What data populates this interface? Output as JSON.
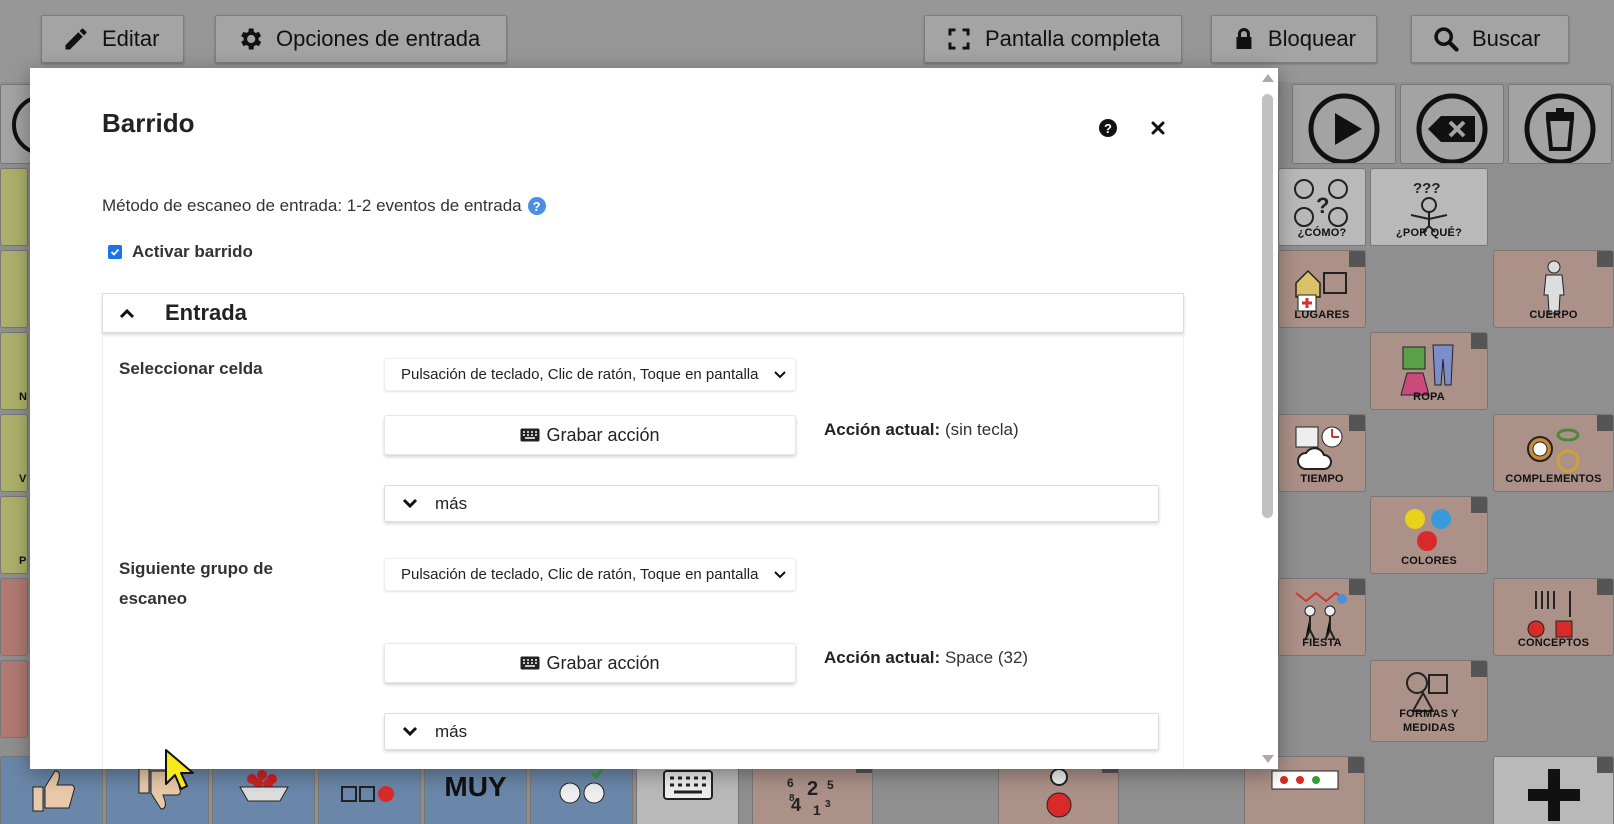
{
  "toolbar": {
    "edit_label": "Editar",
    "input_options_label": "Opciones de entrada",
    "fullscreen_label": "Pantalla completa",
    "lock_label": "Bloquear",
    "search_label": "Buscar"
  },
  "grid_cells": {
    "como": "¿CÓMO?",
    "porque": "¿POR QUÉ?",
    "lugares": "LUGARES",
    "cuerpo": "CUERPO",
    "ropa": "ROPA",
    "tiempo": "TIEMPO",
    "complementos": "COMPLEMENTOS",
    "colores": "COLORES",
    "fiesta": "FIESTA",
    "conceptos": "CONCEPTOS",
    "formas": "FORMAS Y\nMEDIDAS",
    "muy": "MUY",
    "left_partial": [
      "NO",
      "VC",
      "PE"
    ]
  },
  "modal": {
    "title": "Barrido",
    "method_text": "Método de escaneo de entrada: 1-2 eventos de entrada",
    "activate_label": "Activar barrido",
    "activate_checked": true,
    "section_title": "Entrada",
    "select_cell": {
      "label": "Seleccionar celda",
      "select_value": "Pulsación de teclado, Clic de ratón, Toque en pantalla",
      "record_label": "Grabar acción",
      "current_label": "Acción actual:",
      "current_value": "(sin tecla)",
      "more_label": "más"
    },
    "next_group": {
      "label": "Siguiente grupo de escaneo",
      "select_value": "Pulsación de teclado, Clic de ratón, Toque en pantalla",
      "record_label": "Grabar acción",
      "current_label": "Acción actual:",
      "current_value": "Space (32)",
      "more_label": "más"
    }
  }
}
